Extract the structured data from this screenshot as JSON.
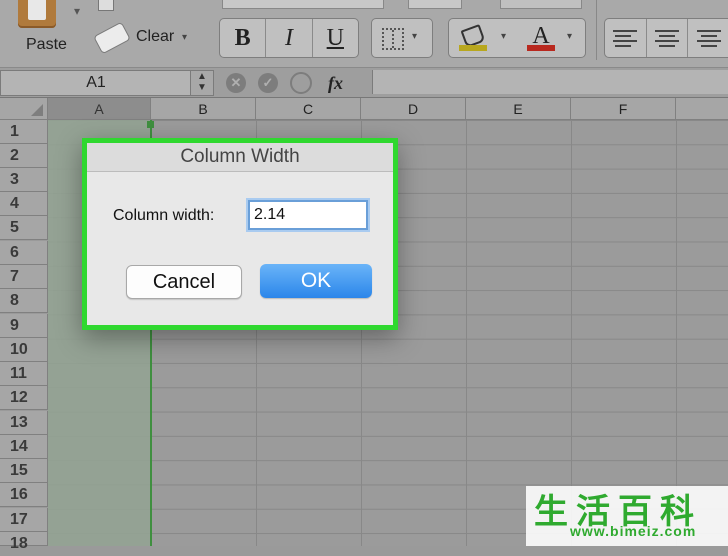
{
  "ribbon": {
    "paste_label": "Paste",
    "clear_label": "Clear",
    "bold_label": "B",
    "italic_label": "I",
    "underline_label": "U",
    "font_color_label": "A",
    "fill_color": "#b8a71e",
    "font_color": "#b8281e"
  },
  "formula_bar": {
    "name_box": "A1",
    "stepper": "▲▼",
    "cancel_icon": "✕",
    "confirm_icon": "✓",
    "fx_label": "fx"
  },
  "columns": [
    "A",
    "B",
    "C",
    "D",
    "E",
    "F"
  ],
  "rows": [
    "1",
    "2",
    "3",
    "4",
    "5",
    "6",
    "7",
    "8",
    "9",
    "10",
    "11",
    "12",
    "13",
    "14",
    "15",
    "16",
    "17",
    "18"
  ],
  "selected_column": "A",
  "dialog": {
    "title": "Column Width",
    "field_label": "Column width:",
    "field_value": "2.14",
    "cancel_label": "Cancel",
    "ok_label": "OK",
    "highlight_color": "#2fd82f",
    "ok_color": "#2b86ea"
  },
  "watermark": {
    "chars": "生活百科",
    "url": "www.bimeiz.com"
  }
}
